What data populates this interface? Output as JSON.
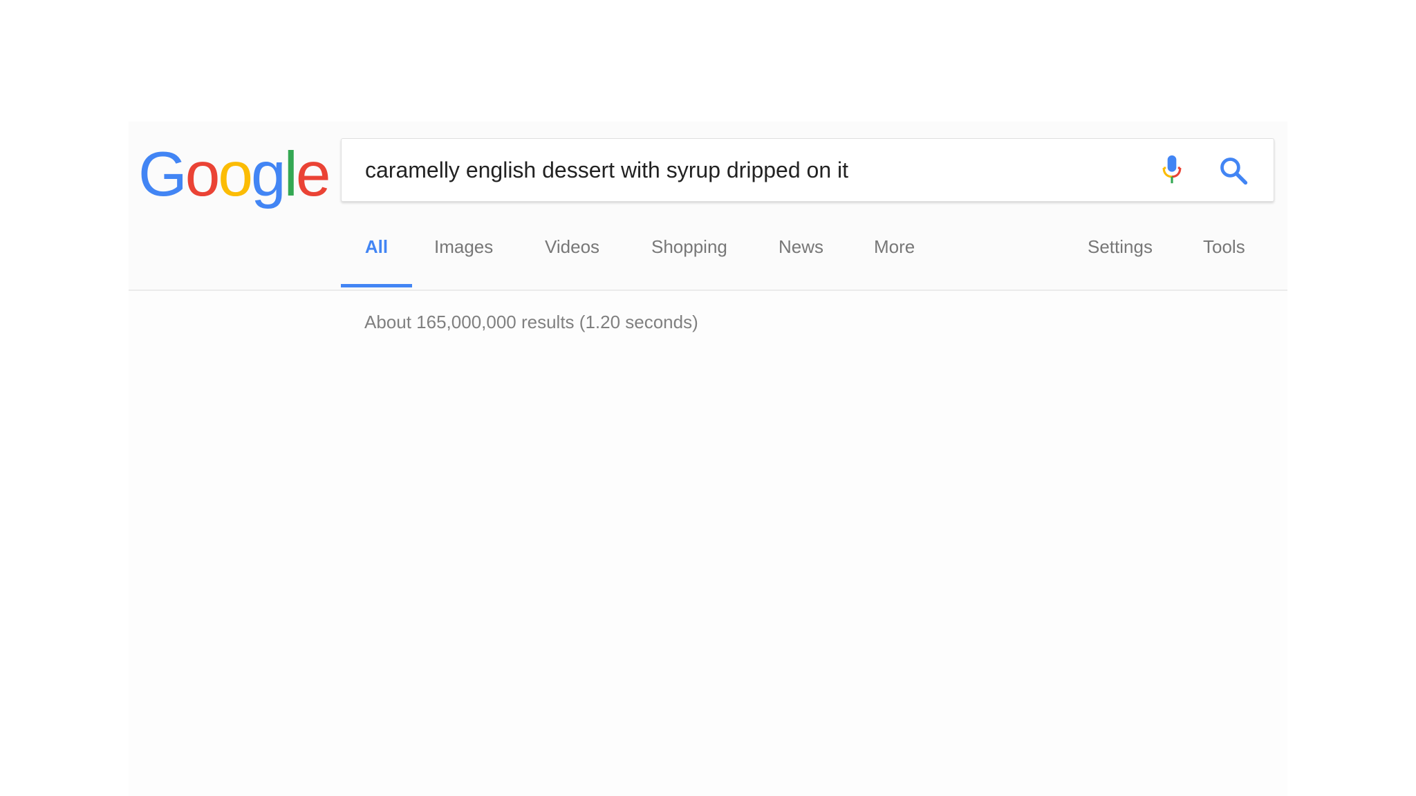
{
  "logo": {
    "letters": [
      {
        "char": "G",
        "color": "#4285f4"
      },
      {
        "char": "o",
        "color": "#ea4335"
      },
      {
        "char": "o",
        "color": "#fbbc05"
      },
      {
        "char": "g",
        "color": "#4285f4"
      },
      {
        "char": "l",
        "color": "#34a853"
      },
      {
        "char": "e",
        "color": "#ea4335"
      }
    ]
  },
  "search": {
    "query": "caramelly english dessert with syrup dripped on it",
    "mic_icon": "microphone-icon",
    "search_icon": "search-icon",
    "accent_color": "#4285f4"
  },
  "tabs": [
    {
      "label": "All",
      "active": true
    },
    {
      "label": "Images",
      "active": false
    },
    {
      "label": "Videos",
      "active": false
    },
    {
      "label": "Shopping",
      "active": false
    },
    {
      "label": "News",
      "active": false
    },
    {
      "label": "More",
      "active": false
    }
  ],
  "tools": {
    "settings_label": "Settings",
    "tools_label": "Tools"
  },
  "results": {
    "stats": "About 165,000,000 results (1.20 seconds)"
  }
}
